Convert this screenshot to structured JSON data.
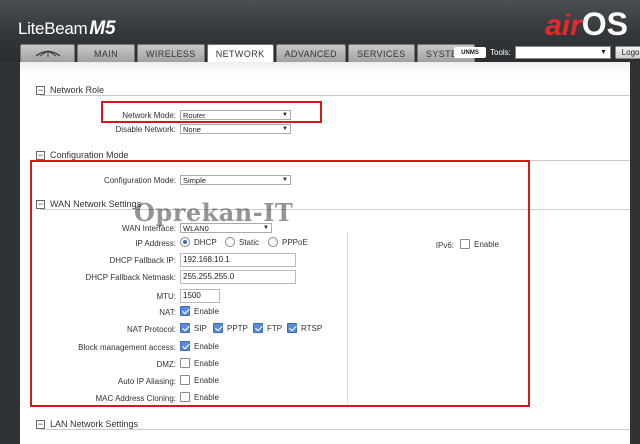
{
  "header": {
    "brand_name": "LiteBeam",
    "brand_model": "M5",
    "os_air": "air",
    "os_os": "OS"
  },
  "tabs": [
    "MAIN",
    "WIRELESS",
    "NETWORK",
    "ADVANCED",
    "SERVICES",
    "SYSTEM"
  ],
  "tools": {
    "unms_label": "UNMS",
    "tools_label": "Tools:",
    "tools_value": "",
    "logout_label": "Logout"
  },
  "network_role": {
    "title": "Network Role",
    "network_mode_label": "Network Mode:",
    "network_mode_value": "Router",
    "disable_network_label": "Disable Network:",
    "disable_network_value": "None"
  },
  "configuration_mode": {
    "title": "Configuration Mode",
    "label": "Configuration Mode:",
    "value": "Simple"
  },
  "wan": {
    "title": "WAN Network Settings",
    "wan_interface_label": "WAN Interface:",
    "wan_interface_value": "WLAN0",
    "ip_address_label": "IP Address:",
    "ip_options": [
      "DHCP",
      "Static",
      "PPPoE"
    ],
    "ip_selected": "DHCP",
    "fallback_ip_label": "DHCP Fallback IP:",
    "fallback_ip_value": "192.168.10.1",
    "fallback_netmask_label": "DHCP Fallback Netmask:",
    "fallback_netmask_value": "255.255.255.0",
    "mtu_label": "MTU:",
    "mtu_value": "1500",
    "nat_label": "NAT:",
    "nat_enable": "Enable",
    "nat_protocol_label": "NAT Protocol:",
    "nat_protocols": [
      "SIP",
      "PPTP",
      "FTP",
      "RTSP"
    ],
    "block_mgmt_label": "Block management access:",
    "dmz_label": "DMZ:",
    "auto_ip_label": "Auto IP Aliasing:",
    "mac_clone_label": "MAC Address Cloning:",
    "enable_label": "Enable",
    "ipv6_label": "IPv6:",
    "ipv6_enable": "Enable"
  },
  "lan": {
    "title": "LAN Network Settings"
  },
  "watermark": "Oprekan-IT"
}
